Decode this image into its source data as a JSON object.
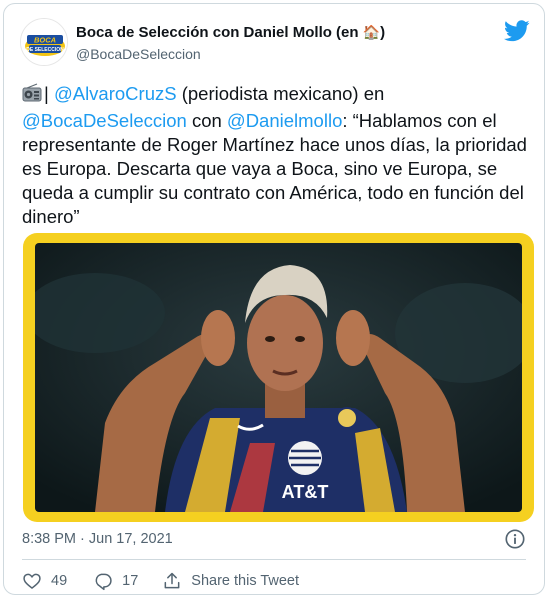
{
  "author": {
    "display_name": "Boca de Selección con Daniel Mollo (en ",
    "display_emoji": "🏠",
    "display_suffix": ")",
    "handle": "@BocaDeSeleccion",
    "avatar_logo_text": "BOCA DE SELECCION"
  },
  "icons": {
    "brand": "twitter-bird-icon",
    "radio": "radio-icon",
    "info": "info-icon",
    "like": "heart-icon",
    "reply": "reply-icon",
    "share": "share-icon"
  },
  "tweet": {
    "segments": [
      {
        "text": "| ",
        "type": "text"
      },
      {
        "text": "@AlvaroCruzS",
        "type": "mention"
      },
      {
        "text": " (periodista mexicano) en ",
        "type": "text"
      },
      {
        "text": "@BocaDeSeleccion",
        "type": "mention"
      },
      {
        "text": " con ",
        "type": "text"
      },
      {
        "text": "@Danielmollo",
        "type": "mention"
      },
      {
        "text": ": “Hablamos con el representante de Roger Martínez hace unos días, la prioridad es Europa. Descarta que vaya a Boca, sino ve Europa, se queda a cumplir su contrato con América, todo en función del dinero”",
        "type": "text"
      }
    ]
  },
  "media": {
    "jersey_sponsor": "AT&T",
    "frame_color": "#F5D020"
  },
  "timestamp": "8:38 PM · Jun 17, 2021",
  "actions": {
    "likes": "49",
    "replies": "17",
    "share_label": "Share this Tweet"
  },
  "colors": {
    "link": "#1D9BF0",
    "secondary_text": "#536471",
    "brand_blue": "#1D9BF0",
    "border": "#CFD9DE"
  }
}
